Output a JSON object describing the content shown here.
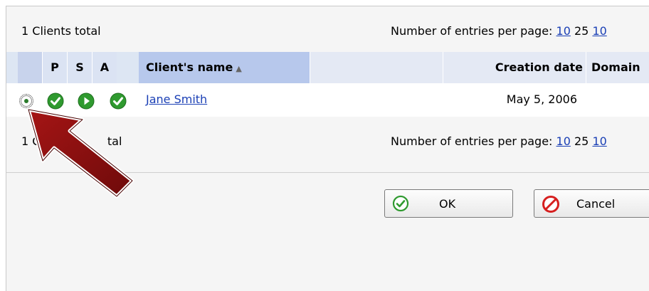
{
  "top_bar": {
    "total": "1 Clients total",
    "per_page_label": "Number of entries per page:",
    "options": [
      "10",
      "25",
      "10"
    ]
  },
  "table": {
    "columns": {
      "p": "P",
      "s": "S",
      "a": "A",
      "name": "Client's name",
      "name_sort": "▲",
      "creation_date": "Creation date",
      "domain": "Domain"
    },
    "rows": [
      {
        "client_name": "Jane Smith",
        "creation_date": "May 5, 2006",
        "selected": true
      }
    ]
  },
  "bottom_bar": {
    "total_visible": "1 Cl",
    "total_tail": "tal",
    "per_page_label": "Number of entries per page:",
    "options": [
      "10",
      "25",
      "10"
    ]
  },
  "buttons": {
    "ok": "OK",
    "cancel": "Cancel"
  },
  "colors": {
    "status_green": "#2f9a2f",
    "link": "#1a3fb5",
    "arrow": "#8b0f0f",
    "header_sorted": "#b7c8ec"
  },
  "icons": {
    "p": "check-icon",
    "s": "play-icon",
    "a": "check-icon",
    "ok": "ok-check-icon",
    "cancel": "cancel-icon"
  }
}
